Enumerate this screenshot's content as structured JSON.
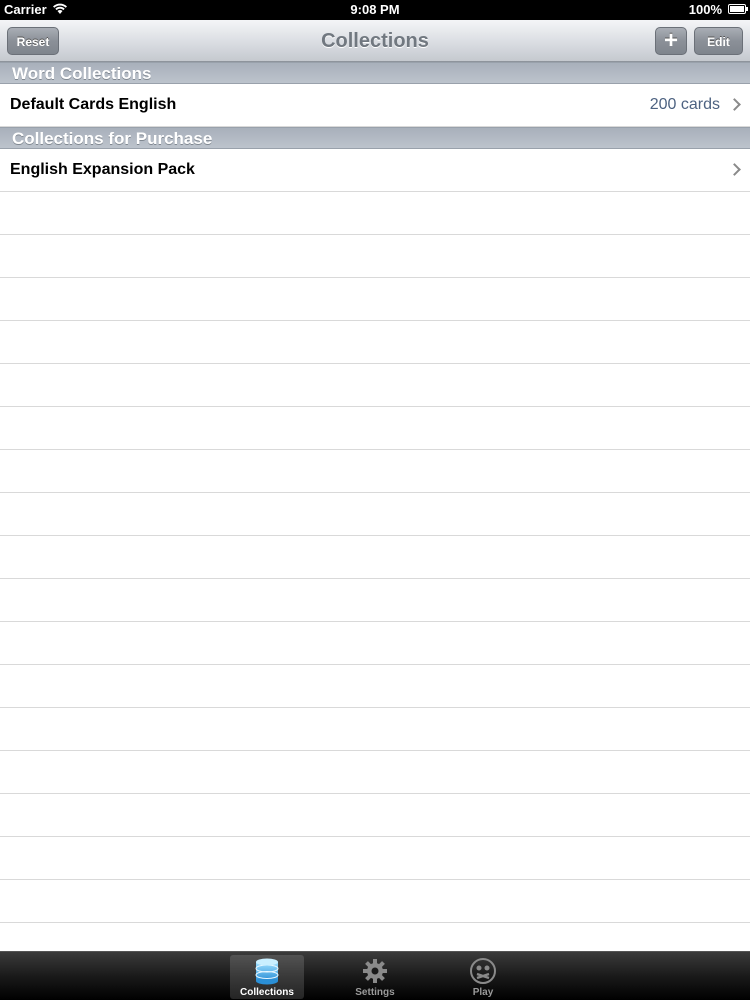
{
  "status_bar": {
    "carrier": "Carrier",
    "time": "9:08 PM",
    "battery": "100%"
  },
  "nav_bar": {
    "title": "Collections",
    "reset_label": "Reset",
    "add_label": "+",
    "edit_label": "Edit"
  },
  "sections": [
    {
      "header": "Word Collections",
      "rows": [
        {
          "title": "Default Cards English",
          "detail": "200 cards"
        }
      ]
    },
    {
      "header": "Collections for Purchase",
      "rows": [
        {
          "title": "English Expansion Pack"
        }
      ]
    }
  ],
  "tab_bar": {
    "tabs": [
      {
        "label": "Collections",
        "icon": "database-icon",
        "selected": true
      },
      {
        "label": "Settings",
        "icon": "gear-icon",
        "selected": false
      },
      {
        "label": "Play",
        "icon": "play-face-icon",
        "selected": false
      }
    ]
  },
  "colors": {
    "accent_detail": "#4d6281",
    "section_header": "#a8b0bb",
    "nav_title": "#717880"
  }
}
